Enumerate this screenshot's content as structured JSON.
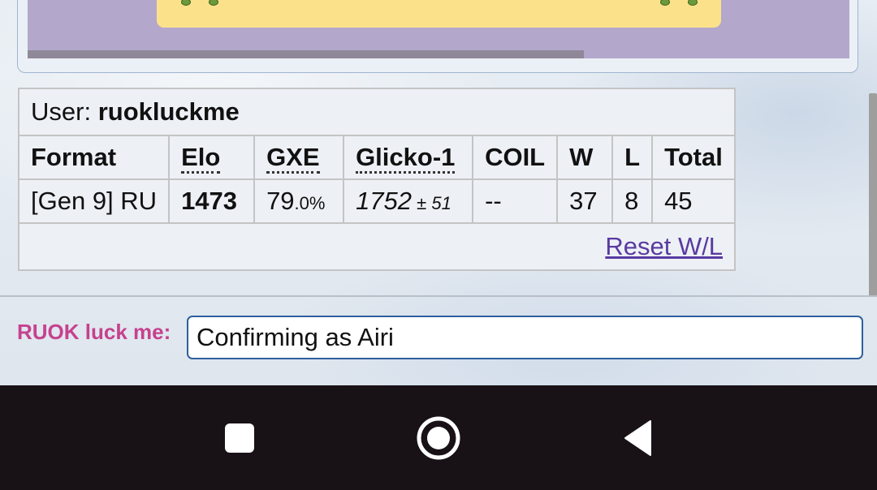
{
  "user": {
    "prefix": "User: ",
    "name": "ruokluckme"
  },
  "ladder": {
    "headers": [
      "Format",
      "Elo",
      "GXE",
      "Glicko-1",
      "COIL",
      "W",
      "L",
      "Total"
    ],
    "row": {
      "format": "[Gen 9] RU",
      "elo": "1473",
      "gxe_main": "79",
      "gxe_small": ".0%",
      "glicko_main": "1752",
      "glicko_small": " ± 51",
      "coil": "--",
      "w": "37",
      "l": "8",
      "total": "45"
    },
    "reset_label": "Reset W/L"
  },
  "chat": {
    "label": "RUOK luck me:",
    "input_value": "Confirming as Airi"
  },
  "navbar": {
    "icons": [
      "recents-square-icon",
      "home-circle-icon",
      "back-triangle-icon"
    ]
  },
  "colors": {
    "battle_field": "#b3a7cb",
    "dialog_box": "#fbe28a",
    "chat_label": "#c6418e",
    "link": "#5a3aa0",
    "navbar": "#181216"
  }
}
